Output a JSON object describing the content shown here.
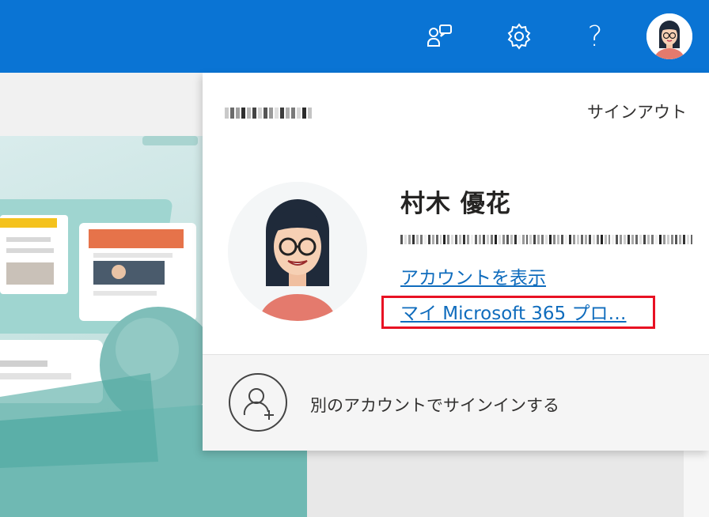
{
  "topbar": {
    "background": "#0a74d4",
    "icons": [
      "feedback-icon",
      "gear-icon",
      "help-icon"
    ],
    "help_glyph": "?"
  },
  "flyout": {
    "sign_out_label": "サインアウト",
    "user": {
      "name": "村木 優花"
    },
    "links": {
      "view_account": "アカウントを表示",
      "my_profile": "マイ Microsoft 365 プロ…"
    },
    "other_account_label": "別のアカウントでサインインする",
    "highlight_color": "#e81123",
    "link_color": "#0f6cbd"
  }
}
